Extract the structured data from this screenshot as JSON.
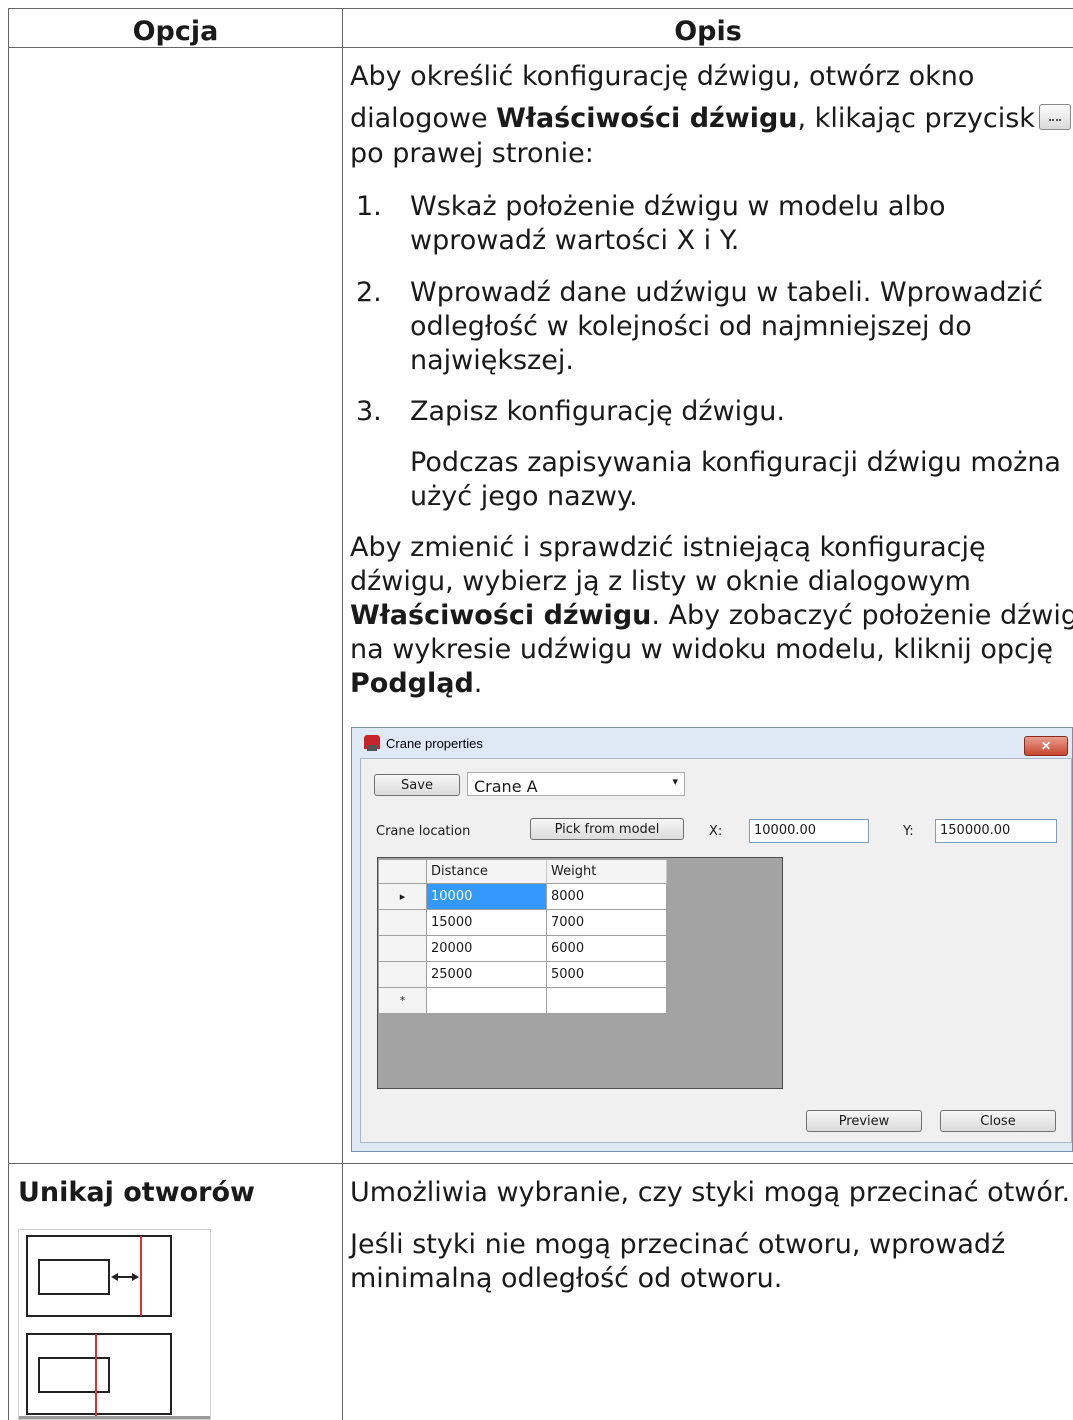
{
  "header": {
    "col1": "Opcja",
    "col2": "Opis"
  },
  "row1": {
    "intro_lines": [
      "Aby określić konfigurację dźwigu, otwórz okno",
      "po prawej stronie:"
    ],
    "intro_line2_pre": "dialogowe ",
    "intro_line2_bold": "Właściwości dźwigu",
    "intro_line2_post": ", klikając przycisk",
    "inline_button_icon": "ellipsis-button-icon",
    "steps": [
      {
        "num": "1.",
        "lines": [
          "Wskaż położenie dźwigu w modelu albo",
          "wprowadź wartości X i Y."
        ]
      },
      {
        "num": "2.",
        "lines": [
          "Wprowadź dane udźwigu w tabeli. Wprowadzić",
          "odległość w kolejności od najmniejszej do",
          "największej."
        ]
      },
      {
        "num": "3.",
        "lines": [
          "Zapisz konfigurację dźwigu."
        ]
      }
    ],
    "step3_note": [
      "Podczas zapisywania konfiguracji dźwigu można",
      "użyć jego nazwy."
    ],
    "para2_l1": "Aby zmienić i sprawdzić istniejącą konfigurację",
    "para2_l2": "dźwigu, wybierz ją z listy w oknie dialogowym",
    "para2_l3_bold": "Właściwości dźwigu",
    "para2_l3_post": ". Aby zobaczyć położenie dźwigu",
    "para2_l4": "na wykresie udźwigu w widoku modelu, kliknij opcję",
    "para2_l5_bold": "Podgląd",
    "para2_l5_post": "."
  },
  "dialog": {
    "title": "Crane properties",
    "close_glyph": "✕",
    "save_label": "Save",
    "combo_value": "Crane A",
    "combo_arrow": "▾",
    "location_label": "Crane location",
    "pick_label": "Pick from model",
    "x_label": "X:",
    "x_value": "10000.00",
    "y_label": "Y:",
    "y_value": "150000.00",
    "grid": {
      "headers": [
        "Distance",
        "Weight"
      ],
      "rows": [
        [
          "10000",
          "8000"
        ],
        [
          "15000",
          "7000"
        ],
        [
          "20000",
          "6000"
        ],
        [
          "25000",
          "5000"
        ]
      ],
      "current_row_glyph": "▸",
      "new_row_glyph": "*"
    },
    "preview_label": "Preview",
    "close_label": "Close"
  },
  "row2": {
    "option": "Unikaj otworów",
    "desc1": "Umożliwia wybranie, czy styki mogą przecinać otwór.",
    "desc2_l1": "Jeśli styki nie mogą przecinać otworu, wprowadź",
    "desc2_l2": "minimalną odległość od otworu."
  }
}
